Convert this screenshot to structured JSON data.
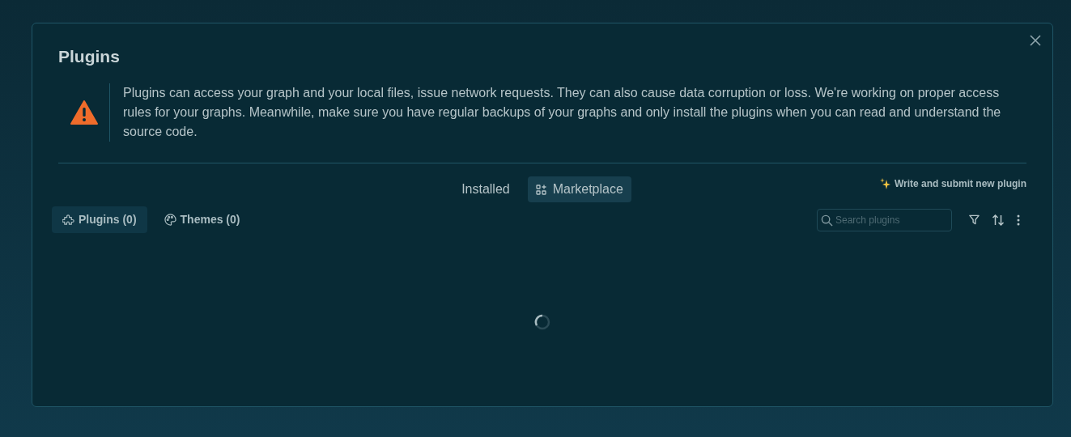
{
  "dialog": {
    "title": "Plugins",
    "warning": "Plugins can access your graph and your local files, issue network requests. They can also cause data corruption or loss. We're working on proper access rules for your graphs. Meanwhile, make sure you have regular backups of your graphs and only install the plugins when you can read and understand the source code.",
    "tabs": [
      {
        "label": "Installed",
        "selected": false
      },
      {
        "label": "Marketplace",
        "selected": true
      }
    ],
    "submit_link": "Write and submit new plugin",
    "categories": [
      {
        "label": "Plugins (0)",
        "selected": true,
        "kind": "plugins"
      },
      {
        "label": "Themes (0)",
        "selected": false,
        "kind": "themes"
      }
    ],
    "search": {
      "placeholder": "Search plugins"
    },
    "loading": true
  }
}
